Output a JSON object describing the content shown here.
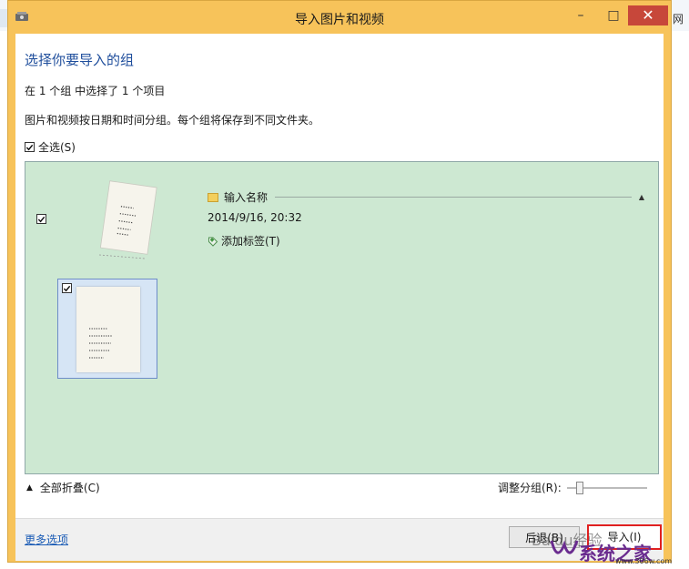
{
  "background": {
    "right_text": "网"
  },
  "window": {
    "title": "导入图片和视频",
    "controls": {
      "minimize": "–",
      "maximize": "□",
      "close": "✕"
    }
  },
  "dialog": {
    "heading": "选择你要导入的组",
    "selection_status": "在 1 个组 中选择了 1 个项目",
    "description": "图片和视频按日期和时间分组。每个组将保存到不同文件夹。",
    "select_all": {
      "label": "全选(S)",
      "checked": true
    }
  },
  "group": {
    "checked": true,
    "name_placeholder": "输入名称",
    "datetime": "2014/9/16, 20:32",
    "add_tag": "添加标签(T)",
    "collapse_arrow": "▲",
    "items": [
      {
        "checked": true
      }
    ]
  },
  "bottom_bar": {
    "collapse_all": "全部折叠(C)",
    "collapse_all_arrow": "▲",
    "adjust_groups": "调整分组(R):"
  },
  "footer": {
    "more_options": "更多选项",
    "back_button": "后退(B)",
    "import_button": "导入(I)"
  },
  "watermark": {
    "baidu": "Baidu经验",
    "logo": "系统之家",
    "url": "www.306w.com"
  },
  "colors": {
    "window_border": "#f7c35a",
    "group_area": "#cde8d2",
    "heading": "#1f4e9c",
    "close_button": "#c7473a",
    "highlight": "#e02020"
  }
}
